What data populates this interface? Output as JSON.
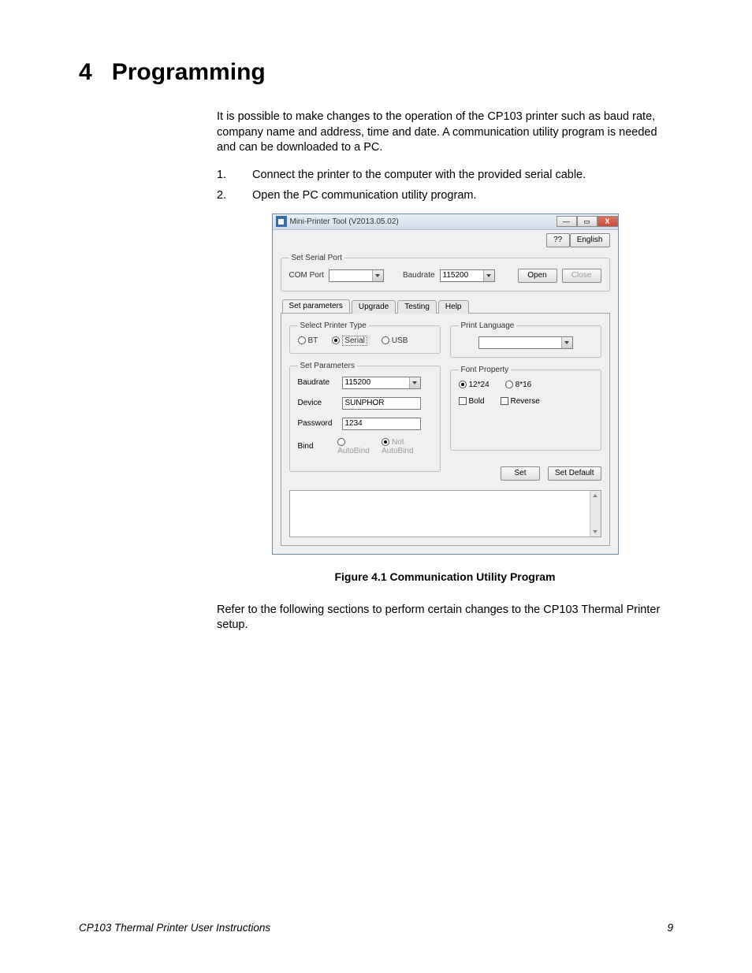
{
  "chapter": {
    "num": "4",
    "title": "Programming"
  },
  "intro": "It is possible to make changes to the operation of the CP103 printer such as baud rate, company name and address, time and date. A communication utility program is needed and can be downloaded to a PC.",
  "steps": [
    {
      "n": "1.",
      "t": "Connect the printer to the computer with the provided serial cable."
    },
    {
      "n": "2.",
      "t": "Open the PC communication utility program."
    }
  ],
  "dialog": {
    "title": "Mini-Printer Tool (V2013.05.02)",
    "help_btn": "??",
    "lang_btn": "English",
    "serial": {
      "legend": "Set Serial Port",
      "com_label": "COM Port",
      "com_value": "",
      "baud_label": "Baudrate",
      "baud_value": "115200",
      "open": "Open",
      "close": "Close"
    },
    "tabs": [
      "Set parameters",
      "Upgrade",
      "Testing",
      "Help"
    ],
    "printer_type": {
      "legend": "Select Printer Type",
      "bt": "BT",
      "serial": "Serial",
      "usb": "USB"
    },
    "print_lang": {
      "legend": "Print Language",
      "value": ""
    },
    "params": {
      "legend": "Set Parameters",
      "baud_label": "Baudrate",
      "baud_value": "115200",
      "device_label": "Device",
      "device_value": "SUNPHOR",
      "pass_label": "Password",
      "pass_value": "1234",
      "bind_label": "Bind",
      "autobind": "AutoBind",
      "notautobind": "Not AutoBind"
    },
    "font": {
      "legend": "Font Property",
      "s1": "12*24",
      "s2": "8*16",
      "bold": "Bold",
      "reverse": "Reverse"
    },
    "set_btn": "Set",
    "default_btn": "Set Default"
  },
  "figure_caption": "Figure 4.1  Communication Utility Program",
  "outro": "Refer to the following sections to perform certain changes to the CP103 Thermal Printer setup.",
  "footer": {
    "left": "CP103 Thermal Printer User Instructions",
    "right": "9"
  }
}
